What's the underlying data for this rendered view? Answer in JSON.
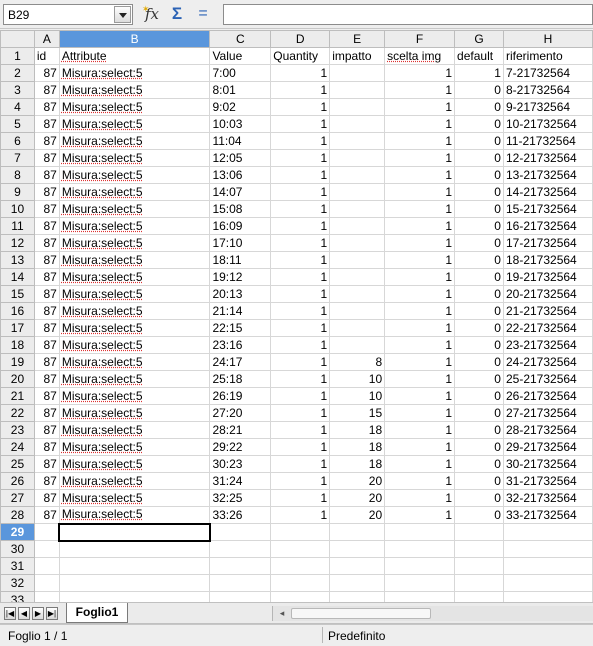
{
  "formula_bar": {
    "name_box": "B29",
    "formula": "",
    "function_wizard_icon": "fx-function-wizard-icon",
    "sum_icon": "sigma-sum-icon",
    "equals_icon": "equals-formula-icon"
  },
  "columns": [
    {
      "letter": "A",
      "header": "id",
      "align": "num"
    },
    {
      "letter": "B",
      "header": "Attribute",
      "align": "txt"
    },
    {
      "letter": "C",
      "header": "Value",
      "align": "txt"
    },
    {
      "letter": "D",
      "header": "Quantity",
      "align": "num"
    },
    {
      "letter": "E",
      "header": "impatto",
      "align": "num"
    },
    {
      "letter": "F",
      "header": "scelta img",
      "align": "num"
    },
    {
      "letter": "G",
      "header": "default",
      "align": "num"
    },
    {
      "letter": "H",
      "header": "riferimento",
      "align": "txt"
    }
  ],
  "selected_column": "B",
  "selected_row": 29,
  "rows": [
    [
      "87",
      "Misura:select:5",
      "7:00",
      "1",
      "",
      "1",
      "1",
      "7-21732564"
    ],
    [
      "87",
      "Misura:select:5",
      "8:01",
      "1",
      "",
      "1",
      "0",
      "8-21732564"
    ],
    [
      "87",
      "Misura:select:5",
      "9:02",
      "1",
      "",
      "1",
      "0",
      "9-21732564"
    ],
    [
      "87",
      "Misura:select:5",
      "10:03",
      "1",
      "",
      "1",
      "0",
      "10-21732564"
    ],
    [
      "87",
      "Misura:select:5",
      "11:04",
      "1",
      "",
      "1",
      "0",
      "11-21732564"
    ],
    [
      "87",
      "Misura:select:5",
      "12:05",
      "1",
      "",
      "1",
      "0",
      "12-21732564"
    ],
    [
      "87",
      "Misura:select:5",
      "13:06",
      "1",
      "",
      "1",
      "0",
      "13-21732564"
    ],
    [
      "87",
      "Misura:select:5",
      "14:07",
      "1",
      "",
      "1",
      "0",
      "14-21732564"
    ],
    [
      "87",
      "Misura:select:5",
      "15:08",
      "1",
      "",
      "1",
      "0",
      "15-21732564"
    ],
    [
      "87",
      "Misura:select:5",
      "16:09",
      "1",
      "",
      "1",
      "0",
      "16-21732564"
    ],
    [
      "87",
      "Misura:select:5",
      "17:10",
      "1",
      "",
      "1",
      "0",
      "17-21732564"
    ],
    [
      "87",
      "Misura:select:5",
      "18:11",
      "1",
      "",
      "1",
      "0",
      "18-21732564"
    ],
    [
      "87",
      "Misura:select:5",
      "19:12",
      "1",
      "",
      "1",
      "0",
      "19-21732564"
    ],
    [
      "87",
      "Misura:select:5",
      "20:13",
      "1",
      "",
      "1",
      "0",
      "20-21732564"
    ],
    [
      "87",
      "Misura:select:5",
      "21:14",
      "1",
      "",
      "1",
      "0",
      "21-21732564"
    ],
    [
      "87",
      "Misura:select:5",
      "22:15",
      "1",
      "",
      "1",
      "0",
      "22-21732564"
    ],
    [
      "87",
      "Misura:select:5",
      "23:16",
      "1",
      "",
      "1",
      "0",
      "23-21732564"
    ],
    [
      "87",
      "Misura:select:5",
      "24:17",
      "1",
      "8",
      "1",
      "0",
      "24-21732564"
    ],
    [
      "87",
      "Misura:select:5",
      "25:18",
      "1",
      "10",
      "1",
      "0",
      "25-21732564"
    ],
    [
      "87",
      "Misura:select:5",
      "26:19",
      "1",
      "10",
      "1",
      "0",
      "26-21732564"
    ],
    [
      "87",
      "Misura:select:5",
      "27:20",
      "1",
      "15",
      "1",
      "0",
      "27-21732564"
    ],
    [
      "87",
      "Misura:select:5",
      "28:21",
      "1",
      "18",
      "1",
      "0",
      "28-21732564"
    ],
    [
      "87",
      "Misura:select:5",
      "29:22",
      "1",
      "18",
      "1",
      "0",
      "29-21732564"
    ],
    [
      "87",
      "Misura:select:5",
      "30:23",
      "1",
      "18",
      "1",
      "0",
      "30-21732564"
    ],
    [
      "87",
      "Misura:select:5",
      "31:24",
      "1",
      "20",
      "1",
      "0",
      "31-21732564"
    ],
    [
      "87",
      "Misura:select:5",
      "32:25",
      "1",
      "20",
      "1",
      "0",
      "32-21732564"
    ],
    [
      "87",
      "Misura:select:5",
      "33:26",
      "1",
      "20",
      "1",
      "0",
      "33-21732564"
    ]
  ],
  "empty_row_numbers": [
    29,
    30,
    31,
    32,
    33
  ],
  "sheet_tabs": [
    {
      "label": "Foglio1",
      "active": true
    }
  ],
  "tab_nav_icons": [
    "first-sheet-icon",
    "prev-sheet-icon",
    "next-sheet-icon",
    "last-sheet-icon"
  ],
  "status_bar": {
    "sheet_info": "Foglio 1 / 1",
    "page_style": "Predefinito"
  },
  "colors": {
    "selection_accent": "#5a96dc",
    "header_bg": "#ececec",
    "grid_line": "#d7d7d7",
    "spellcheck_underline": "#d33"
  }
}
